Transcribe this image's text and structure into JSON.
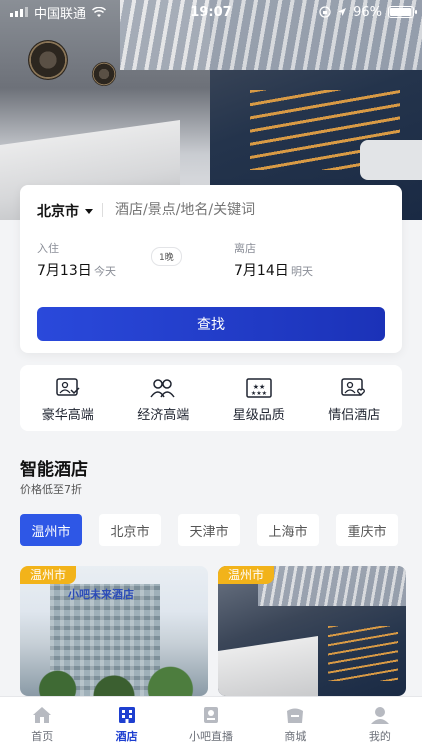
{
  "status_bar": {
    "carrier": "中国联通",
    "time": "19:07",
    "battery_percent": "96%",
    "battery_level": 0.96
  },
  "search_card": {
    "city": "北京市",
    "search_placeholder": "酒店/景点/地名/关键词",
    "checkin_label": "入住",
    "checkin_date": "7月13日",
    "checkin_day": "今天",
    "nights": "1晚",
    "checkout_label": "离店",
    "checkout_date": "7月14日",
    "checkout_day": "明天",
    "search_button": "查找"
  },
  "categories": [
    {
      "label": "豪华高端",
      "icon": "luxury-photo-icon"
    },
    {
      "label": "经济高端",
      "icon": "people-icon"
    },
    {
      "label": "星级品质",
      "icon": "stars-icon"
    },
    {
      "label": "情侣酒店",
      "icon": "heart-photo-icon"
    }
  ],
  "section": {
    "title": "智能酒店",
    "subtitle": "价格低至7折",
    "cities": [
      "温州市",
      "北京市",
      "天津市",
      "上海市",
      "重庆市"
    ],
    "active_city": "温州市"
  },
  "hotels": [
    {
      "tag": "温州市",
      "sign": "小吧未来酒店"
    },
    {
      "tag": "温州市"
    }
  ],
  "tab_bar": {
    "tabs": [
      {
        "label": "首页",
        "icon": "home-icon"
      },
      {
        "label": "酒店",
        "icon": "hotel-icon"
      },
      {
        "label": "小吧直播",
        "icon": "live-icon"
      },
      {
        "label": "商城",
        "icon": "mall-icon"
      },
      {
        "label": "我的",
        "icon": "profile-icon"
      }
    ],
    "active": "酒店"
  },
  "colors": {
    "accent": "#2e57e6",
    "tag": "#f2b31a",
    "button": "#1b32b8"
  }
}
